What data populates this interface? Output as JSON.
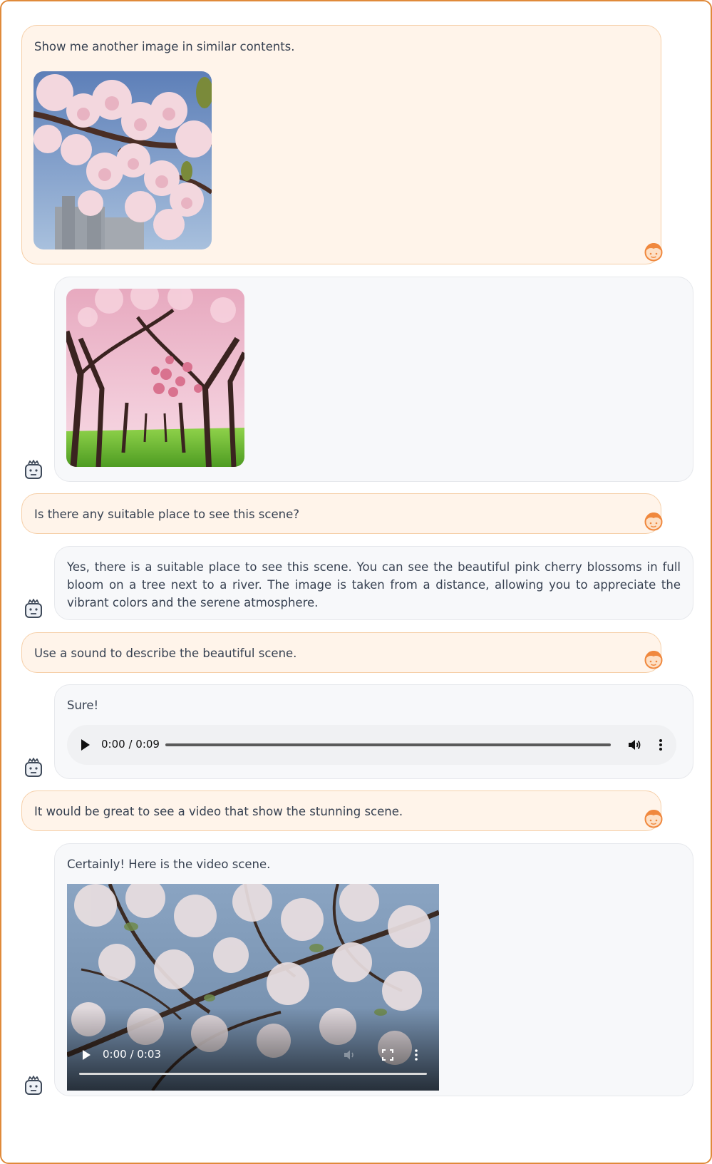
{
  "conversation": {
    "messages": [
      {
        "role": "user",
        "text": "Show me another image in similar contents.",
        "attachment": "image"
      },
      {
        "role": "assistant",
        "text": "",
        "attachment": "image"
      },
      {
        "role": "user",
        "text": "Is there any suitable place to see this scene?"
      },
      {
        "role": "assistant",
        "text": "Yes, there is a suitable place to see this scene. You can see the beautiful pink cherry blossoms in full bloom on a tree next to a river. The image is taken from a distance, allowing you to appreciate the vibrant colors and the serene atmosphere."
      },
      {
        "role": "user",
        "text": "Use a sound to describe the beautiful scene."
      },
      {
        "role": "assistant",
        "text": "Sure!",
        "attachment": "audio"
      },
      {
        "role": "user",
        "text": "It would be great to see a video that show the stunning scene."
      },
      {
        "role": "assistant",
        "text": "Certainly! Here is the video scene.",
        "attachment": "video"
      }
    ]
  },
  "audio_player": {
    "time": "0:00 / 0:09",
    "progress": 0
  },
  "video_player": {
    "time": "0:00 / 0:03",
    "progress": 0
  },
  "icons": {
    "user_avatar": "user-avatar-icon",
    "bot_avatar": "robot-avatar-icon",
    "play": "play-icon",
    "volume": "volume-icon",
    "more": "more-vertical-icon",
    "fullscreen": "fullscreen-icon"
  },
  "colors": {
    "frame_border": "#e08a3a",
    "user_bubble": "#fff4ea",
    "bot_bubble": "#f7f8fa",
    "avatar_accent": "#f0883e"
  }
}
